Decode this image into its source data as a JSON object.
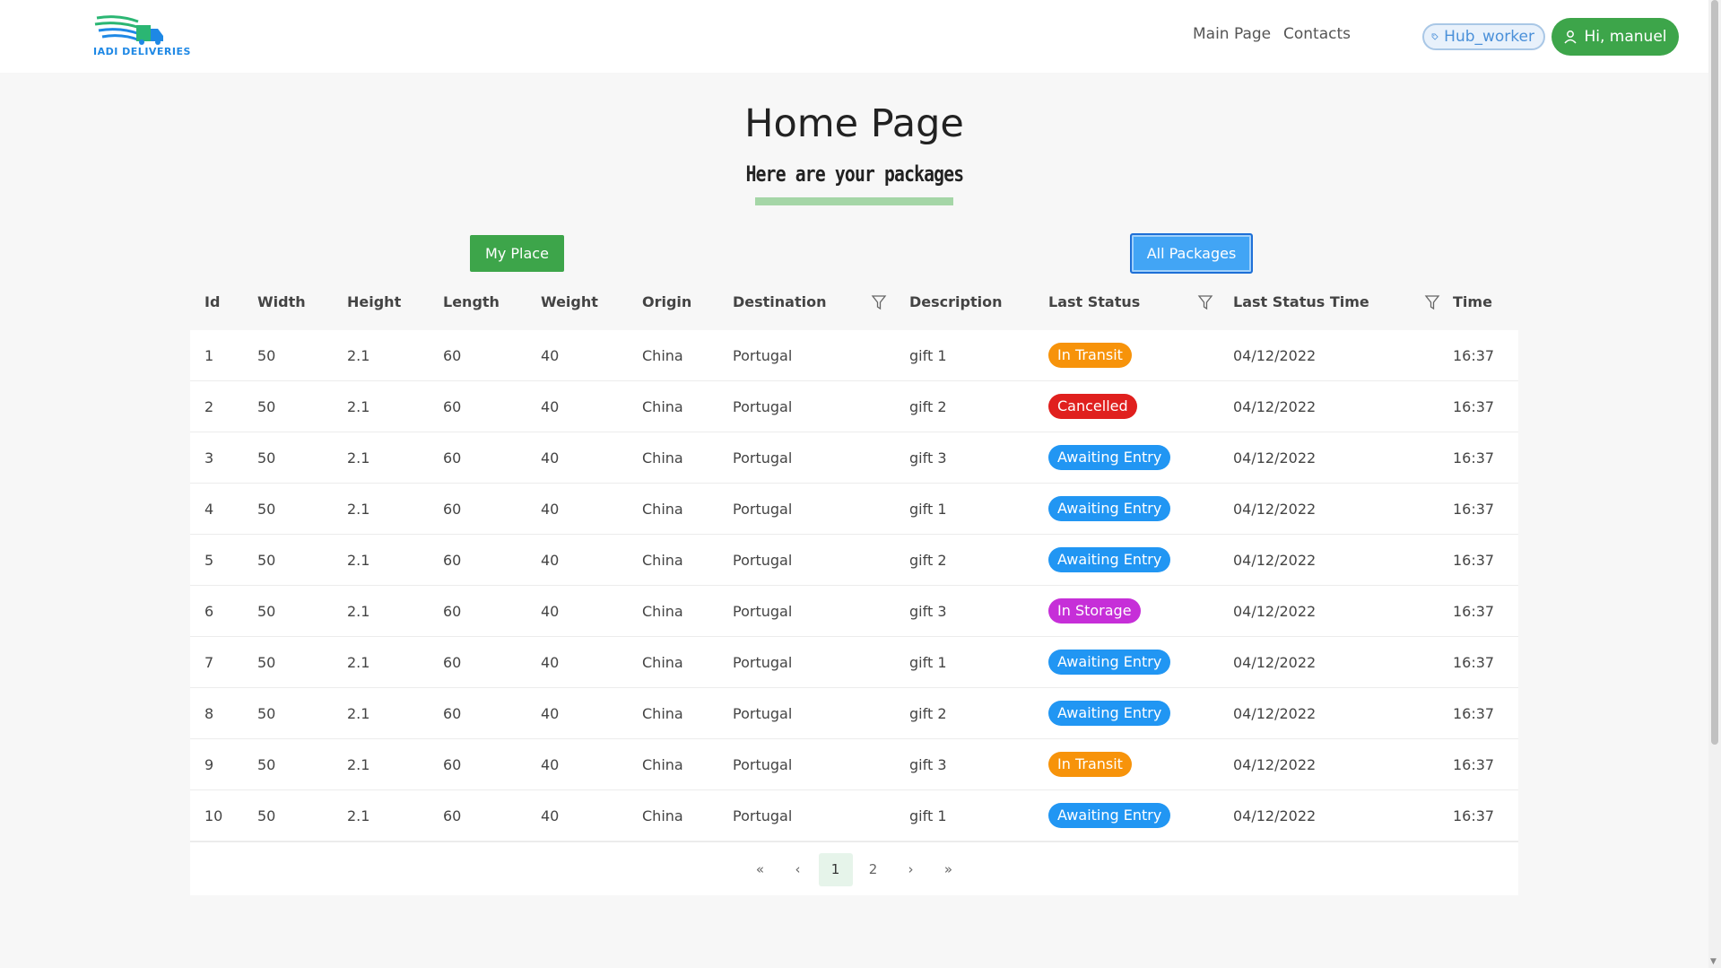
{
  "nav": {
    "logo_text": "IADI DELIVERIES",
    "links": [
      "Main Page",
      "Contacts"
    ],
    "role_badge": "Hub_worker",
    "user_greeting": "Hi, manuel"
  },
  "page": {
    "title": "Home Page",
    "subtitle": "Here are your packages"
  },
  "buttons": {
    "my_place": "My Place",
    "all_packages": "All Packages"
  },
  "table": {
    "headers": [
      "Id",
      "Width",
      "Height",
      "Length",
      "Weight",
      "Origin",
      "Destination",
      "Description",
      "Last Status",
      "Last Status Time",
      "Time"
    ],
    "rows": [
      {
        "id": "1",
        "width": "50",
        "height": "2.1",
        "length": "60",
        "weight": "40",
        "origin": "China",
        "destination": "Portugal",
        "description": "gift 1",
        "status": "In Transit",
        "status_time": "04/12/2022",
        "time": "16:37"
      },
      {
        "id": "2",
        "width": "50",
        "height": "2.1",
        "length": "60",
        "weight": "40",
        "origin": "China",
        "destination": "Portugal",
        "description": "gift 2",
        "status": "Cancelled",
        "status_time": "04/12/2022",
        "time": "16:37"
      },
      {
        "id": "3",
        "width": "50",
        "height": "2.1",
        "length": "60",
        "weight": "40",
        "origin": "China",
        "destination": "Portugal",
        "description": "gift 3",
        "status": "Awaiting Entry",
        "status_time": "04/12/2022",
        "time": "16:37"
      },
      {
        "id": "4",
        "width": "50",
        "height": "2.1",
        "length": "60",
        "weight": "40",
        "origin": "China",
        "destination": "Portugal",
        "description": "gift 1",
        "status": "Awaiting Entry",
        "status_time": "04/12/2022",
        "time": "16:37"
      },
      {
        "id": "5",
        "width": "50",
        "height": "2.1",
        "length": "60",
        "weight": "40",
        "origin": "China",
        "destination": "Portugal",
        "description": "gift 2",
        "status": "Awaiting Entry",
        "status_time": "04/12/2022",
        "time": "16:37"
      },
      {
        "id": "6",
        "width": "50",
        "height": "2.1",
        "length": "60",
        "weight": "40",
        "origin": "China",
        "destination": "Portugal",
        "description": "gift 3",
        "status": "In Storage",
        "status_time": "04/12/2022",
        "time": "16:37"
      },
      {
        "id": "7",
        "width": "50",
        "height": "2.1",
        "length": "60",
        "weight": "40",
        "origin": "China",
        "destination": "Portugal",
        "description": "gift 1",
        "status": "Awaiting Entry",
        "status_time": "04/12/2022",
        "time": "16:37"
      },
      {
        "id": "8",
        "width": "50",
        "height": "2.1",
        "length": "60",
        "weight": "40",
        "origin": "China",
        "destination": "Portugal",
        "description": "gift 2",
        "status": "Awaiting Entry",
        "status_time": "04/12/2022",
        "time": "16:37"
      },
      {
        "id": "9",
        "width": "50",
        "height": "2.1",
        "length": "60",
        "weight": "40",
        "origin": "China",
        "destination": "Portugal",
        "description": "gift 3",
        "status": "In Transit",
        "status_time": "04/12/2022",
        "time": "16:37"
      },
      {
        "id": "10",
        "width": "50",
        "height": "2.1",
        "length": "60",
        "weight": "40",
        "origin": "China",
        "destination": "Portugal",
        "description": "gift 1",
        "status": "Awaiting Entry",
        "status_time": "04/12/2022",
        "time": "16:37"
      }
    ]
  },
  "pagination": {
    "pages": [
      "1",
      "2"
    ],
    "current": "1"
  },
  "status_colors": {
    "In Transit": "#f7930a",
    "Cancelled": "#e0201e",
    "Awaiting Entry": "#2196f3",
    "In Storage": "#c62fd8"
  }
}
